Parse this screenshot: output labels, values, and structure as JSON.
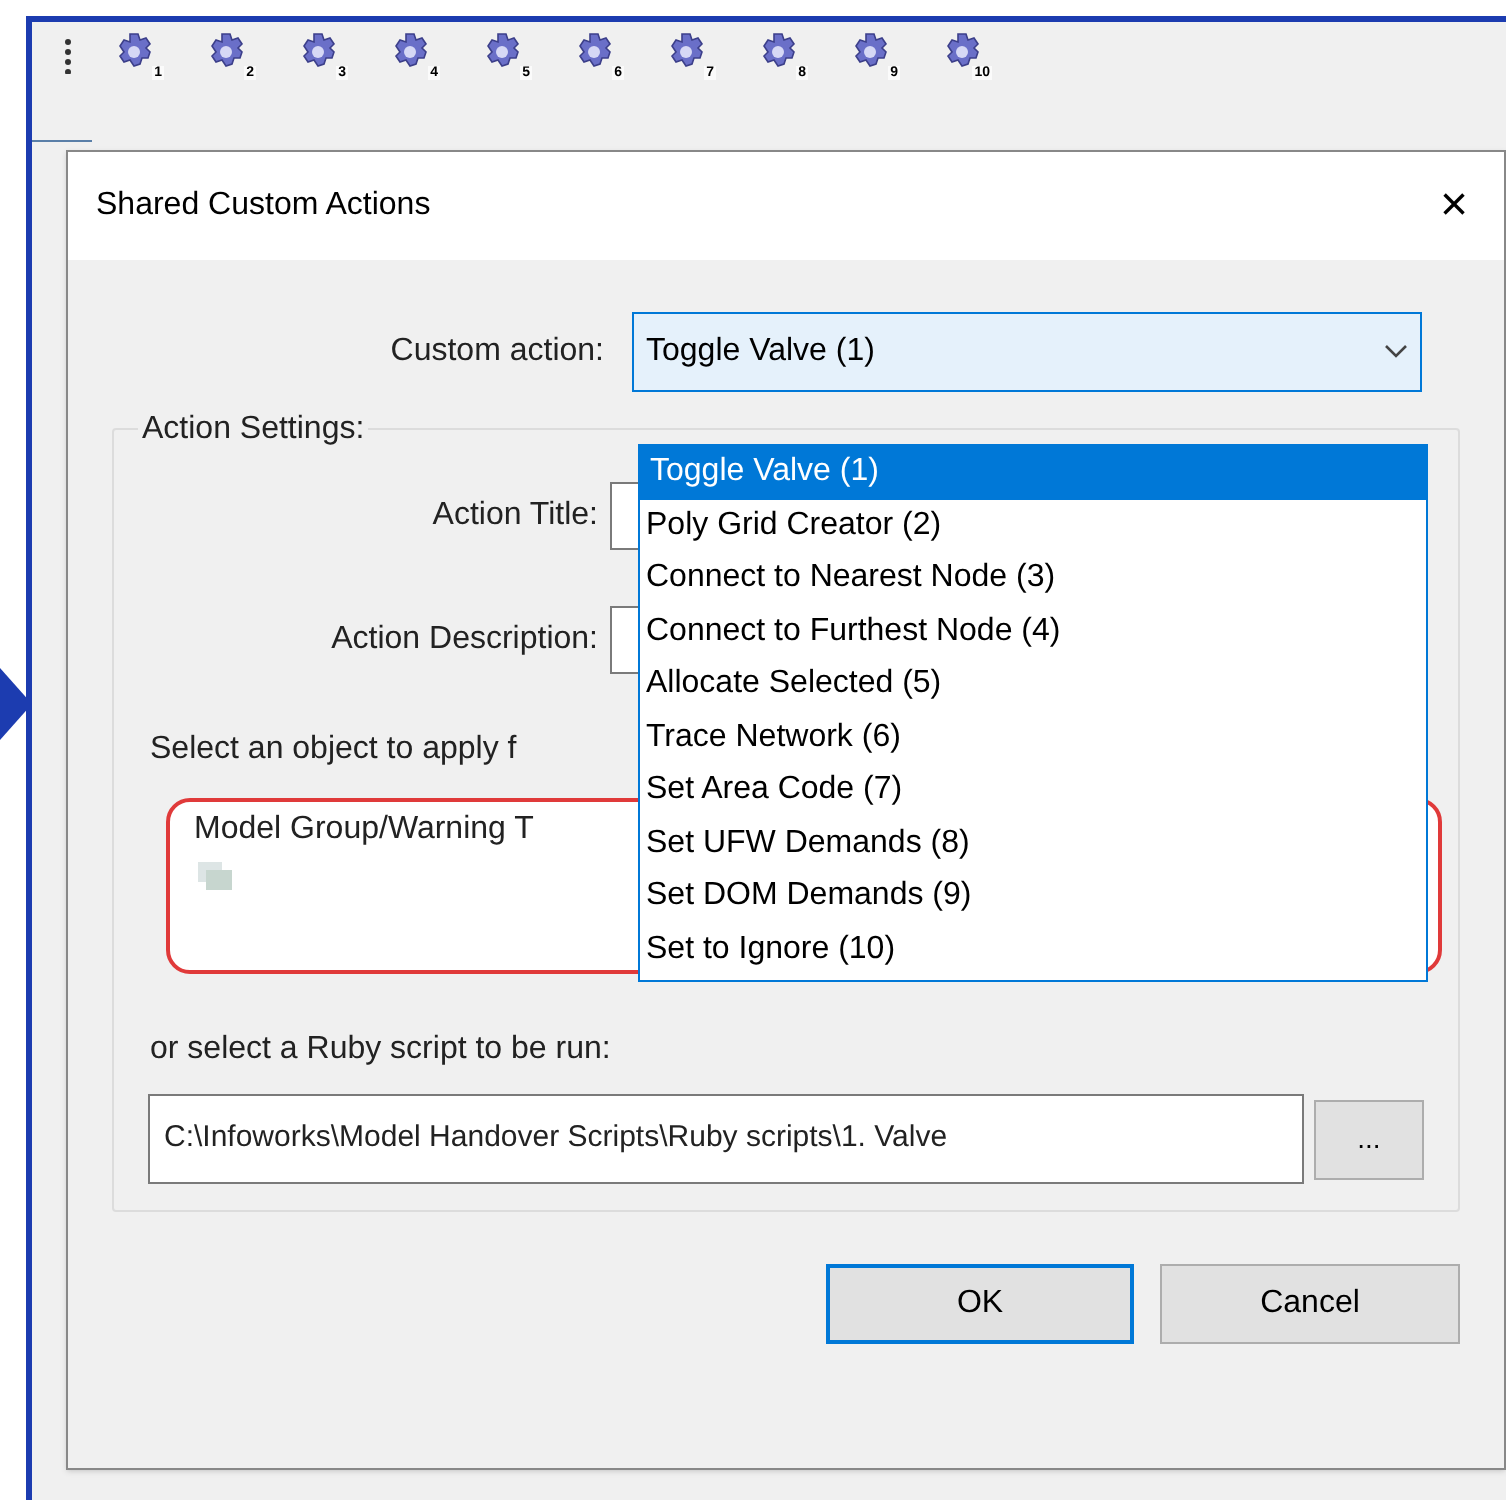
{
  "toolbar": {
    "buttons": [
      {
        "number": "1"
      },
      {
        "number": "2"
      },
      {
        "number": "3"
      },
      {
        "number": "4"
      },
      {
        "number": "5"
      },
      {
        "number": "6"
      },
      {
        "number": "7"
      },
      {
        "number": "8"
      },
      {
        "number": "9"
      },
      {
        "number": "10"
      }
    ]
  },
  "dialog": {
    "title": "Shared Custom Actions",
    "close": "×",
    "custom_action": {
      "label": "Custom action:",
      "value": "Toggle Valve (1)",
      "expanded": true,
      "options": [
        {
          "label": "Toggle Valve (1)",
          "selected": true
        },
        {
          "label": "Poly Grid Creator (2)",
          "selected": false
        },
        {
          "label": "Connect to Nearest Node (3)",
          "selected": false
        },
        {
          "label": "Connect to Furthest Node (4)",
          "selected": false
        },
        {
          "label": "Allocate Selected (5)",
          "selected": false
        },
        {
          "label": "Trace Network (6)",
          "selected": false
        },
        {
          "label": "Set Area Code (7)",
          "selected": false
        },
        {
          "label": "Set UFW Demands (8)",
          "selected": false
        },
        {
          "label": "Set DOM Demands (9)",
          "selected": false
        },
        {
          "label": "Set to Ignore (10)",
          "selected": false
        }
      ]
    },
    "group": {
      "title": "Action Settings:",
      "action_title_label": "Action Title:",
      "action_description_label": "Action Description:",
      "object_prompt": "Select an object to apply f",
      "object_box": {
        "text": "Model Group/Warning T"
      },
      "ruby_prompt": "or select a Ruby script to be run:",
      "ruby_path": "C:\\Infoworks\\Model Handover Scripts\\Ruby scripts\\1. Valve",
      "browse": "..."
    },
    "buttons": [
      "OK",
      "Cancel"
    ]
  }
}
